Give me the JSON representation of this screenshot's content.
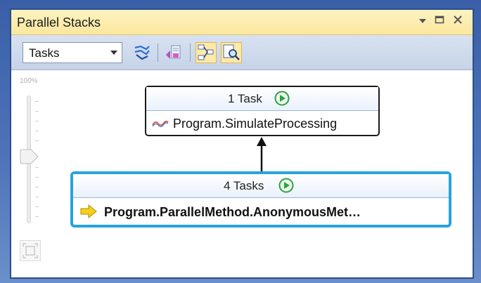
{
  "window": {
    "title": "Parallel Stacks"
  },
  "toolbar": {
    "view_select_value": "Tasks",
    "buttons": [
      {
        "name": "toggle-method-view-icon"
      },
      {
        "name": "auto-scroll-icon"
      },
      {
        "name": "show-external-code-icon"
      },
      {
        "name": "toggle-zoom-control-icon"
      }
    ]
  },
  "zoom": {
    "label": "100%",
    "level_percent": 100
  },
  "frames": {
    "top": {
      "header": "1 Task",
      "method": "Program.SimulateProcessing"
    },
    "bottom": {
      "header": "4 Tasks",
      "method": "Program.ParallelMethod.AnonymousMet…"
    }
  },
  "colors": {
    "accent_blue": "#27a3dc",
    "play_green": "#2ea043",
    "title_bar": "#fbe79d",
    "toolbar": "#c6d3e8",
    "current_arrow": "#f4d21a"
  }
}
